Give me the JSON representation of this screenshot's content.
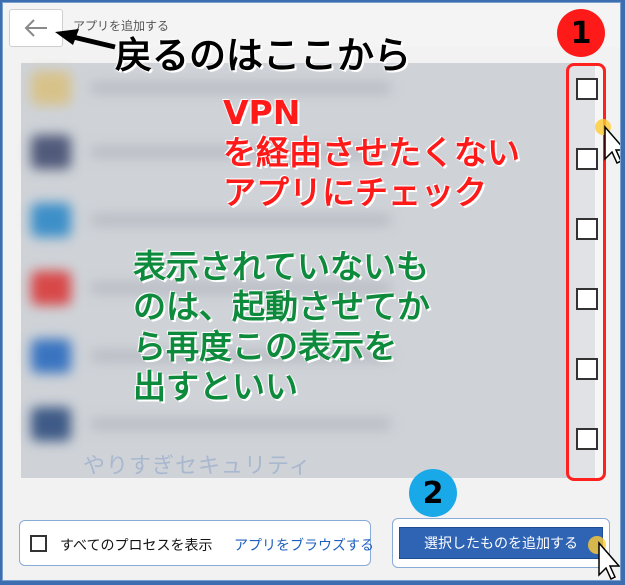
{
  "window": {
    "title": "アプリを追加する"
  },
  "annotations": {
    "back_hint": "戻るのはここから",
    "red_lines": [
      "VPN",
      "を経由させたくない",
      "アプリにチェック"
    ],
    "green_lines": [
      "表示されていないも",
      "のは、起動させてか",
      "ら再度この表示を",
      "出すといい"
    ],
    "badge_1": "1",
    "badge_2": "2",
    "watermark": "やりすぎセキュリティ"
  },
  "footer": {
    "show_all_label": "すべてのプロセスを表示",
    "browse_link": "アプリをブラウズする",
    "add_button": "選択したものを追加する"
  },
  "colors": {
    "accent": "#2f63b4",
    "annotation_red": "#ff1a1a",
    "annotation_green": "#0e8a3c",
    "annotation_badge_blue": "#1aa9e8"
  },
  "icons": {
    "back": "arrow-left-icon"
  }
}
